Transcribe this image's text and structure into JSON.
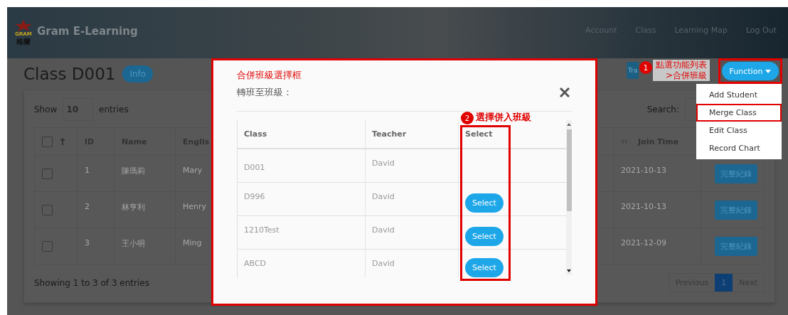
{
  "header": {
    "logo_text": "GRAM",
    "logo_subtext": "格蘭",
    "brand": "Gram E-Learning",
    "nav": [
      "Account",
      "Class",
      "Learning Map",
      "Log Out"
    ]
  },
  "page": {
    "title": "Class D001",
    "info_button": "Info",
    "transfer_button": "Tra",
    "function_button": "Function"
  },
  "length": {
    "label_before": "Show",
    "value": "10",
    "label_after": "entries"
  },
  "search": {
    "label": "Search:"
  },
  "students": {
    "header_checked": false,
    "columns": [
      "ID",
      "Name",
      "Englis"
    ],
    "right_columns": [
      "Join Time"
    ],
    "rows": [
      {
        "checked": false,
        "id": "1",
        "name": "陳瑪莉",
        "english": "Mary",
        "join_time": "2021-10-13",
        "action": "完整紀錄"
      },
      {
        "checked": false,
        "id": "2",
        "name": "林亨利",
        "english": "Henry",
        "join_time": "2021-10-13",
        "action": "完整紀錄"
      },
      {
        "checked": false,
        "id": "3",
        "name": "王小明",
        "english": "Ming",
        "join_time": "2021-12-09",
        "action": "完整紀錄"
      }
    ]
  },
  "table_info": "Showing 1 to 3 of 3 entries",
  "pagination": [
    {
      "label": "Previous",
      "selected": false
    },
    {
      "label": "1",
      "selected": true
    },
    {
      "label": "Next",
      "selected": false
    }
  ],
  "function_menu": [
    {
      "label": "Add Student",
      "highlighted": false
    },
    {
      "label": "Merge Class",
      "highlighted": true
    },
    {
      "label": "Edit Class",
      "highlighted": false
    },
    {
      "label": "Record Chart",
      "highlighted": false
    }
  ],
  "modal": {
    "heading": "合併班級選擇框",
    "subtitle": "轉班至班級：",
    "columns": [
      "Class",
      "Teacher",
      "Select"
    ],
    "rows": [
      {
        "class": "D001",
        "teacher": "David"
      },
      {
        "class": "D996",
        "teacher": "David",
        "action": "Select"
      },
      {
        "class": "1210Test",
        "teacher": "David",
        "action": "Select"
      },
      {
        "class": "ABCD",
        "teacher": "David",
        "action": "Select"
      }
    ]
  },
  "annotations": [
    {
      "number": "1",
      "lines": [
        "點選功能列表",
        ">合併班級"
      ]
    },
    {
      "number": "2",
      "lines": [
        "選擇併入班級"
      ]
    }
  ]
}
